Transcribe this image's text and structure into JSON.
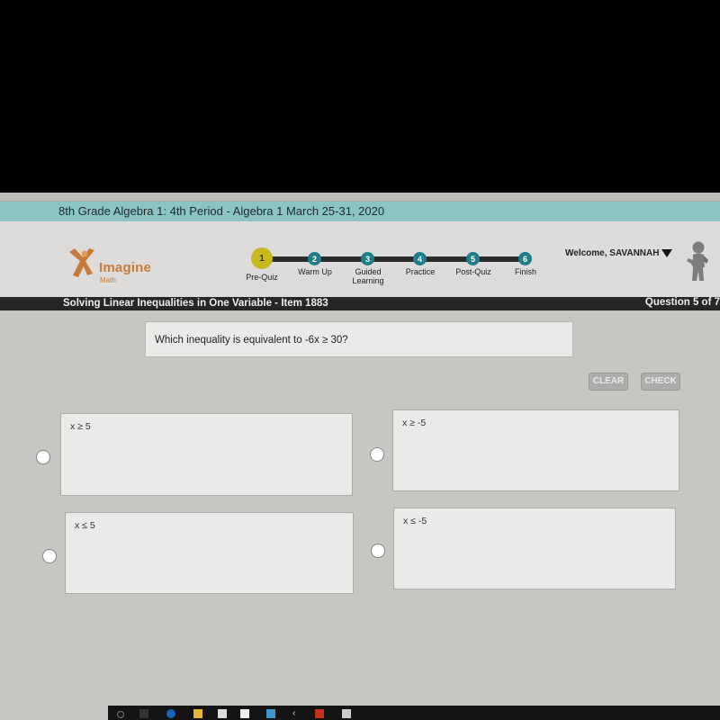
{
  "course": {
    "title": "8th Grade Algebra 1: 4th Period - Algebra 1 March 25-31, 2020"
  },
  "logo": {
    "name": "Imagine",
    "sub": "Math",
    "color": "#c87a38"
  },
  "progress": {
    "current_step": 1,
    "steps": [
      {
        "number": "1",
        "label": "Pre-Quiz",
        "color": "#c8b820",
        "state": "current"
      },
      {
        "number": "2",
        "label": "Warm Up",
        "color": "#1e7f8a",
        "state": "upcoming"
      },
      {
        "number": "3",
        "label": "Guided Learning",
        "color": "#1e7f8a",
        "state": "upcoming"
      },
      {
        "number": "4",
        "label": "Practice",
        "color": "#1e7f8a",
        "state": "upcoming"
      },
      {
        "number": "5",
        "label": "Post-Quiz",
        "color": "#1e7f8a",
        "state": "upcoming"
      },
      {
        "number": "6",
        "label": "Finish",
        "color": "#1e7f8a",
        "state": "upcoming"
      }
    ]
  },
  "user": {
    "welcome": "Welcome, SAVANNAH",
    "avatar_icon": "user-figure-icon"
  },
  "lesson": {
    "title": "Solving Linear Inequalities in One Variable - Item 1883",
    "question_count": "Question 5 of 7"
  },
  "question": {
    "text": "Which inequality is equivalent to -6x ≥ 30?"
  },
  "actions": {
    "clear_label": "CLEAR",
    "check_label": "CHECK"
  },
  "answers": [
    {
      "text": "x ≥ 5",
      "selected": false
    },
    {
      "text": "x ≥ -5",
      "selected": false
    },
    {
      "text": "x ≤ 5",
      "selected": false
    },
    {
      "text": "x ≤ -5",
      "selected": false
    }
  ]
}
